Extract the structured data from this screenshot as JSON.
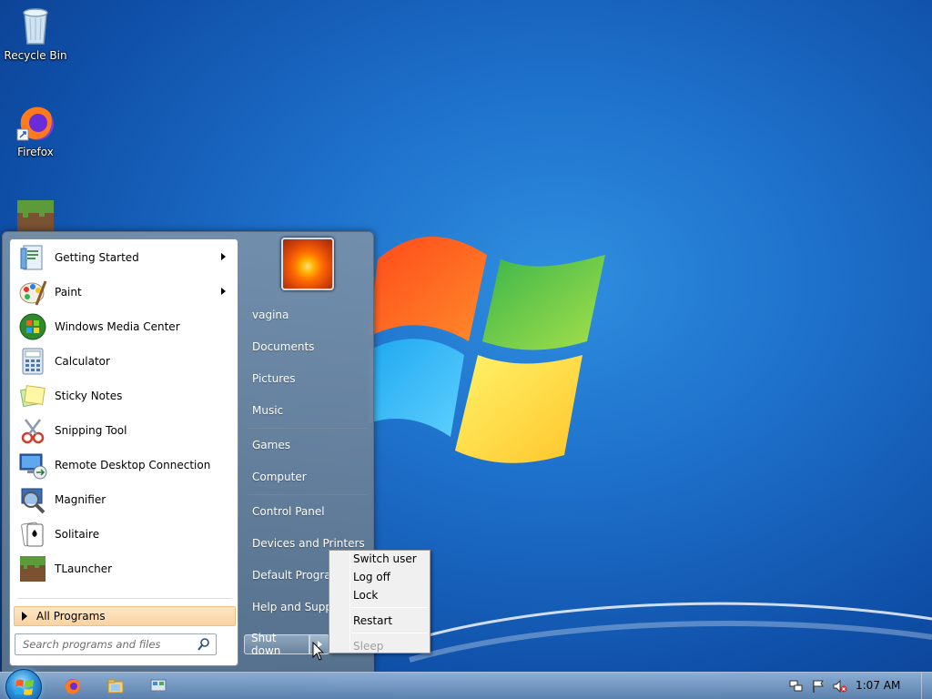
{
  "desktop": {
    "icons": [
      {
        "label": "Recycle Bin",
        "icon": "recycle-bin-icon"
      },
      {
        "label": "Firefox",
        "icon": "firefox-icon"
      },
      {
        "label": "",
        "icon": "tlauncher-icon"
      }
    ]
  },
  "start_menu": {
    "programs": [
      {
        "label": "Getting Started",
        "icon": "getting-started-icon",
        "submenu": true
      },
      {
        "label": "Paint",
        "icon": "paint-icon",
        "submenu": true
      },
      {
        "label": "Windows Media Center",
        "icon": "media-center-icon",
        "submenu": false
      },
      {
        "label": "Calculator",
        "icon": "calculator-icon",
        "submenu": false
      },
      {
        "label": "Sticky Notes",
        "icon": "sticky-notes-icon",
        "submenu": false
      },
      {
        "label": "Snipping Tool",
        "icon": "snipping-tool-icon",
        "submenu": false
      },
      {
        "label": "Remote Desktop Connection",
        "icon": "remote-desktop-icon",
        "submenu": false
      },
      {
        "label": "Magnifier",
        "icon": "magnifier-icon",
        "submenu": false
      },
      {
        "label": "Solitaire",
        "icon": "solitaire-icon",
        "submenu": false
      },
      {
        "label": "TLauncher",
        "icon": "tlauncher-icon",
        "submenu": false
      }
    ],
    "all_programs": "All Programs",
    "search_placeholder": "Search programs and files",
    "right_items": [
      "vagina",
      "Documents",
      "Pictures",
      "Music",
      "Games",
      "Computer",
      "Control Panel",
      "Devices and Printers",
      "Default Programs",
      "Help and Support"
    ],
    "shutdown_label": "Shut down"
  },
  "power_menu": {
    "items": [
      "Switch user",
      "Log off",
      "Lock",
      "Restart",
      "Sleep"
    ],
    "disabled": [
      "Sleep"
    ]
  },
  "taskbar": {
    "pinned": [
      "firefox-icon",
      "explorer-icon",
      "control-panel-icon"
    ],
    "tray": [
      "network-icon",
      "action-center-flag-icon",
      "volume-muted-icon"
    ],
    "clock": "1:07 AM"
  },
  "colors": {
    "desktop_blue": "#1d6fc9",
    "all_programs_highlight": "#f9d3a0"
  }
}
